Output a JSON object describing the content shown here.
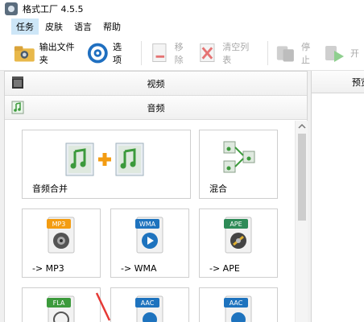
{
  "window": {
    "title": "格式工厂 4.5.5"
  },
  "menu": {
    "items": [
      "任务",
      "皮肤",
      "语言",
      "帮助"
    ],
    "active_index": 0
  },
  "toolbar": {
    "output_folder": "输出文件夹",
    "options": "选项",
    "remove": "移除",
    "clear_list": "清空列表",
    "stop": "停止",
    "start": "开"
  },
  "categories": {
    "video": "视频",
    "audio": "音频"
  },
  "tiles": {
    "audio_merge": "音频合并",
    "mix": "混合",
    "to_mp3": "-> MP3",
    "to_wma": "-> WMA",
    "to_ape": "-> APE",
    "badge_mp3": "MP3",
    "badge_wma": "WMA",
    "badge_ape": "APE",
    "badge_fla": "FLA",
    "badge_aac1": "AAC",
    "badge_aac2": "AAC"
  },
  "right_panel": {
    "header": "预览"
  },
  "colors": {
    "menu_active": "#cde6f7",
    "accent_green": "#5cb85c",
    "arrow_red": "#e53935"
  }
}
